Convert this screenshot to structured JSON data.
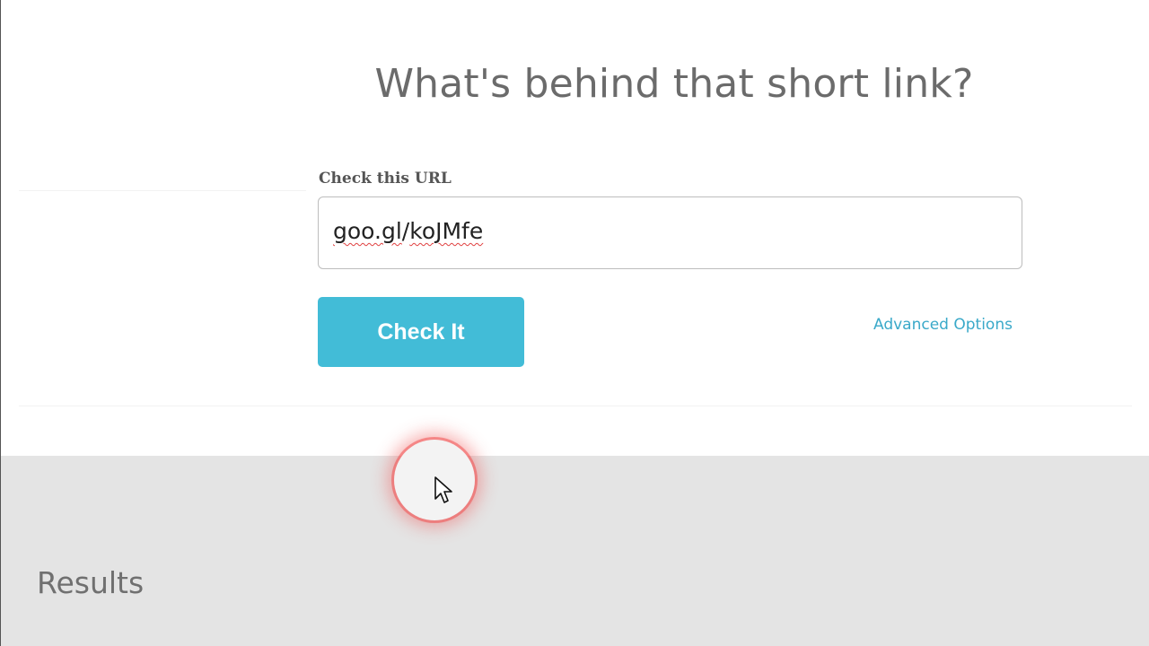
{
  "header": {
    "title": "What's behind that short link?"
  },
  "form": {
    "label": "Check this URL",
    "url_value_host": "goo.gl",
    "url_value_sep": "/",
    "url_value_path": "koJMfe",
    "submit_label": "Check It",
    "advanced_label": "Advanced Options"
  },
  "results": {
    "title": "Results"
  },
  "colors": {
    "accent": "#42bcd7",
    "link": "#3aa9c9",
    "results_bg": "#e4e4e4"
  },
  "icons": {
    "cursor": "mouse-pointer-icon"
  }
}
